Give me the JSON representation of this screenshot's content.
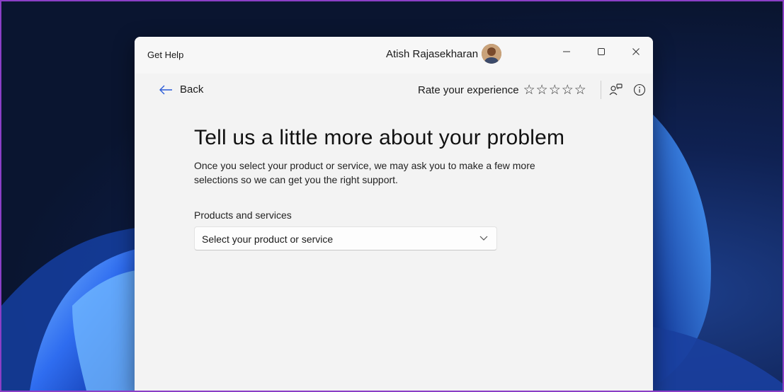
{
  "window": {
    "app_title": "Get Help",
    "user_name": "Atish Rajasekharan"
  },
  "nav": {
    "back_label": "Back",
    "rate_label": "Rate your experience",
    "stars": [
      "☆",
      "☆",
      "☆",
      "☆",
      "☆"
    ],
    "rating": 0
  },
  "main": {
    "heading": "Tell us a little more about your problem",
    "description": "Once you select your product or service, we may ask you to make a few more selections so we can get you the right support.",
    "field_label": "Products and services",
    "select_placeholder": "Select your product or service"
  },
  "colors": {
    "frame_border": "#8b3fc6",
    "window_bg": "#f3f3f3",
    "desktop_bg": "#0d1a3a"
  }
}
